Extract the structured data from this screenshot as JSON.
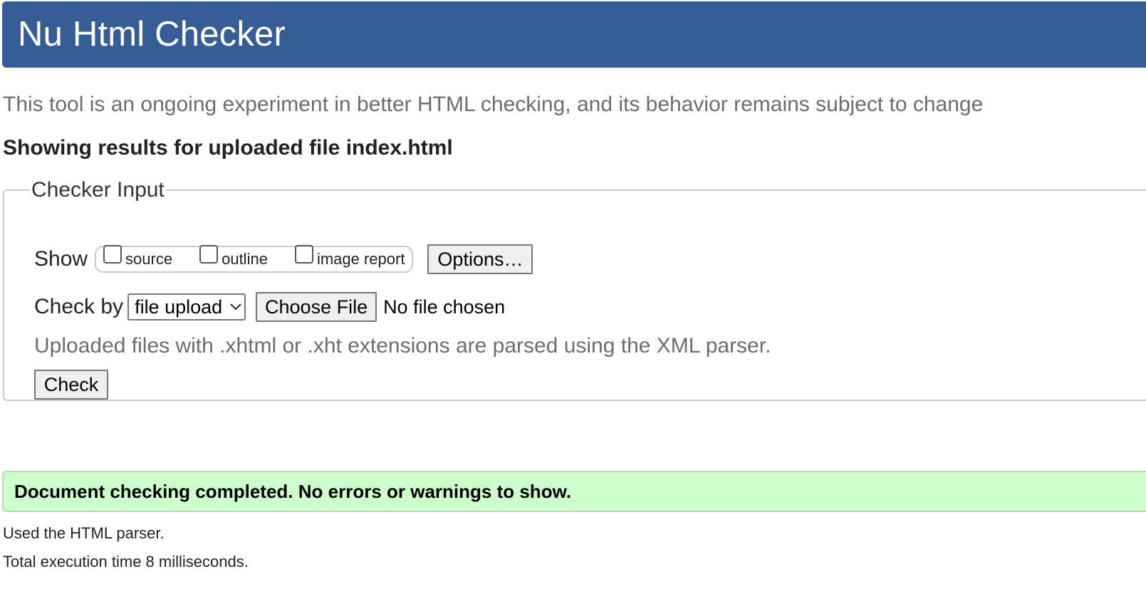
{
  "header": {
    "title": "Nu Html Checker"
  },
  "intro": {
    "text": "This tool is an ongoing experiment in better HTML checking, and its behavior remains subject to change"
  },
  "results_heading": "Showing results for uploaded file index.html",
  "checker": {
    "legend": "Checker Input",
    "show_label": "Show",
    "show_options": [
      {
        "label": "source",
        "checked": false
      },
      {
        "label": "outline",
        "checked": false
      },
      {
        "label": "image report",
        "checked": false
      }
    ],
    "options_button": "Options…",
    "check_by_label": "Check by",
    "check_by_selected": "file upload",
    "choose_file_button": "Choose File",
    "file_status": "No file chosen",
    "help_note": "Uploaded files with .xhtml or .xht extensions are parsed using the XML parser.",
    "check_button": "Check"
  },
  "result": {
    "message": "Document checking completed. No errors or warnings to show.",
    "status_color": "#ccffcc"
  },
  "footer": {
    "parser_note": "Used the HTML parser.",
    "execution_time": "Total execution time 8 milliseconds."
  },
  "colors": {
    "header_bg": "#365d95",
    "muted_text": "#6d6d6d"
  },
  "icons": {
    "select_arrow": "chevron-down-icon"
  }
}
